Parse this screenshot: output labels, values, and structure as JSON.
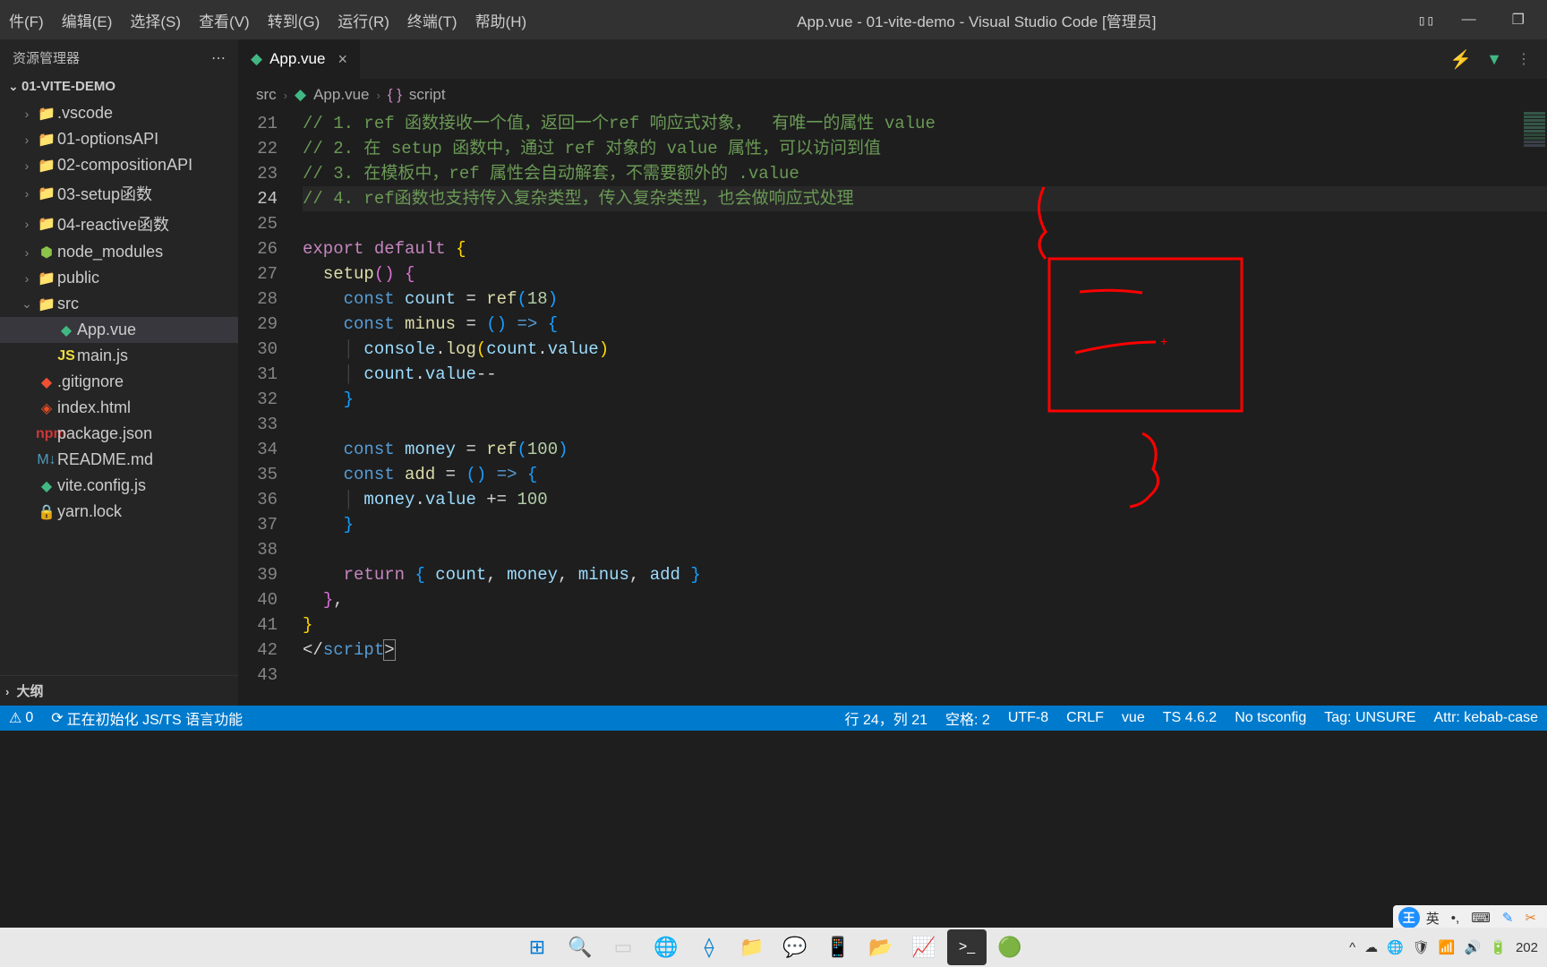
{
  "titlebar": {
    "menu": [
      "件(F)",
      "编辑(E)",
      "选择(S)",
      "查看(V)",
      "转到(G)",
      "运行(R)",
      "终端(T)",
      "帮助(H)"
    ],
    "title": "App.vue - 01-vite-demo - Visual Studio Code [管理员]"
  },
  "sidebar": {
    "header": "资源管理器",
    "project": "01-VITE-DEMO",
    "outline": "大纲",
    "items": [
      {
        "chev": "›",
        "icon": "folder",
        "label": ".vscode",
        "indent": 0
      },
      {
        "chev": "›",
        "icon": "folder",
        "label": "01-optionsAPI",
        "indent": 0
      },
      {
        "chev": "›",
        "icon": "folder",
        "label": "02-compositionAPI",
        "indent": 0
      },
      {
        "chev": "›",
        "icon": "folder",
        "label": "03-setup函数",
        "indent": 0
      },
      {
        "chev": "›",
        "icon": "folder",
        "label": "04-reactive函数",
        "indent": 0
      },
      {
        "chev": "›",
        "icon": "nodemodules",
        "label": "node_modules",
        "indent": 0
      },
      {
        "chev": "›",
        "icon": "folder-green",
        "label": "public",
        "indent": 0
      },
      {
        "chev": "⌄",
        "icon": "folder-green",
        "label": "src",
        "indent": 0
      },
      {
        "chev": "",
        "icon": "vue",
        "label": "App.vue",
        "indent": 1,
        "active": true
      },
      {
        "chev": "",
        "icon": "js",
        "label": "main.js",
        "indent": 1
      },
      {
        "chev": "",
        "icon": "git",
        "label": ".gitignore",
        "indent": 0
      },
      {
        "chev": "",
        "icon": "html",
        "label": "index.html",
        "indent": 0
      },
      {
        "chev": "",
        "icon": "npm",
        "label": "package.json",
        "indent": 0
      },
      {
        "chev": "",
        "icon": "md",
        "label": "README.md",
        "indent": 0
      },
      {
        "chev": "",
        "icon": "vue",
        "label": "vite.config.js",
        "indent": 0
      },
      {
        "chev": "",
        "icon": "lock",
        "label": "yarn.lock",
        "indent": 0
      }
    ]
  },
  "tab": {
    "label": "App.vue"
  },
  "breadcrumb": {
    "src": "src",
    "file": "App.vue",
    "symbol": "script"
  },
  "code": {
    "start": 21,
    "active": 24,
    "lines": [
      {
        "n": 21,
        "html": "<span class='tok-comment'>// 1. ref 函数接收一个值，返回一个ref 响应式对象，  有唯一的属性 value</span>"
      },
      {
        "n": 22,
        "html": "<span class='tok-comment'>// 2. 在 setup 函数中，通过 ref 对象的 value 属性，可以访问到值</span>"
      },
      {
        "n": 23,
        "html": "<span class='tok-comment'>// 3. 在模板中，ref 属性会自动解套，不需要额外的 .value</span>"
      },
      {
        "n": 24,
        "html": "<span class='tok-comment'>// 4. ref函数也支持传入复杂类型，传入复杂类型，也会做响应式处理</span>"
      },
      {
        "n": 25,
        "html": ""
      },
      {
        "n": 26,
        "html": "<span class='tok-keyword'>export</span> <span class='tok-keyword'>default</span> <span class='tok-brace'>{</span>"
      },
      {
        "n": 27,
        "html": "  <span class='tok-func'>setup</span><span class='tok-brace2'>()</span> <span class='tok-brace2'>{</span>"
      },
      {
        "n": 28,
        "html": "    <span class='tok-decl'>const</span> <span class='tok-var'>count</span> <span class='tok-default'>=</span> <span class='tok-func'>ref</span><span class='tok-brace3'>(</span><span class='tok-num'>18</span><span class='tok-brace3'>)</span>"
      },
      {
        "n": 29,
        "html": "    <span class='tok-decl'>const</span> <span class='tok-func'>minus</span> <span class='tok-default'>=</span> <span class='tok-brace3'>()</span> <span class='tok-decl'>=></span> <span class='tok-brace3'>{</span>"
      },
      {
        "n": 30,
        "html": "    <span class='indent-guide'>│</span> <span class='tok-var'>console</span><span class='tok-default'>.</span><span class='tok-func'>log</span><span class='tok-brace'>(</span><span class='tok-var'>count</span><span class='tok-default'>.</span><span class='tok-prop'>value</span><span class='tok-brace'>)</span>"
      },
      {
        "n": 31,
        "html": "    <span class='indent-guide'>│</span> <span class='tok-var'>count</span><span class='tok-default'>.</span><span class='tok-prop'>value</span><span class='tok-default'>--</span>"
      },
      {
        "n": 32,
        "html": "    <span class='tok-brace3'>}</span>"
      },
      {
        "n": 33,
        "html": ""
      },
      {
        "n": 34,
        "html": "    <span class='tok-decl'>const</span> <span class='tok-var'>money</span> <span class='tok-default'>=</span> <span class='tok-func'>ref</span><span class='tok-brace3'>(</span><span class='tok-num'>100</span><span class='tok-brace3'>)</span>"
      },
      {
        "n": 35,
        "html": "    <span class='tok-decl'>const</span> <span class='tok-func'>add</span> <span class='tok-default'>=</span> <span class='tok-brace3'>()</span> <span class='tok-decl'>=></span> <span class='tok-brace3'>{</span>"
      },
      {
        "n": 36,
        "html": "    <span class='indent-guide'>│</span> <span class='tok-var'>money</span><span class='tok-default'>.</span><span class='tok-prop'>value</span> <span class='tok-default'>+=</span> <span class='tok-num'>100</span>"
      },
      {
        "n": 37,
        "html": "    <span class='tok-brace3'>}</span>"
      },
      {
        "n": 38,
        "html": ""
      },
      {
        "n": 39,
        "html": "    <span class='tok-keyword'>return</span> <span class='tok-brace3'>{</span> <span class='tok-var'>count</span><span class='tok-default'>,</span> <span class='tok-var'>money</span><span class='tok-default'>,</span> <span class='tok-var'>minus</span><span class='tok-default'>,</span> <span class='tok-var'>add</span> <span class='tok-brace3'>}</span>"
      },
      {
        "n": 40,
        "html": "  <span class='tok-brace2'>}</span><span class='tok-default'>,</span>"
      },
      {
        "n": 41,
        "html": "<span class='tok-brace'>}</span>"
      },
      {
        "n": 42,
        "html": "<span class='tok-default'>&lt;/</span><span class='tok-tag'>script</span><span class='tok-default' style='outline:1px solid #888'>&gt;</span>"
      },
      {
        "n": 43,
        "html": ""
      }
    ]
  },
  "statusbar": {
    "warnings": "0",
    "init": "正在初始化 JS/TS 语言功能",
    "pos": "行 24，列 21",
    "spaces": "空格: 2",
    "encoding": "UTF-8",
    "eol": "CRLF",
    "lang": "vue",
    "ts": "TS 4.6.2",
    "tsconfig": "No tsconfig",
    "tag": "Tag: UNSURE",
    "attr": "Attr: kebab-case"
  },
  "ime": {
    "badge": "王",
    "lang": "英"
  },
  "taskbar": {
    "time": "202"
  }
}
